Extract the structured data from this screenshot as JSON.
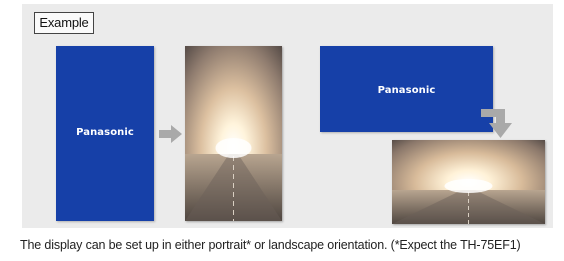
{
  "example_label": "Example",
  "brand_name": "Panasonic",
  "caption": "The display can be set up in either portrait* or landscape orientation. (*Expect the TH-75EF1)",
  "colors": {
    "panel": "#ebebeb",
    "display_blue": "#1640a8",
    "arrow_gray": "#a9a9a9"
  }
}
